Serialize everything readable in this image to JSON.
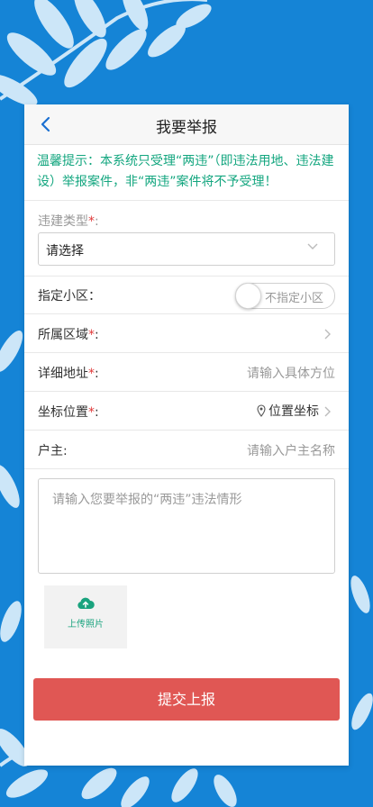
{
  "header": {
    "title": "我要举报"
  },
  "notice": "温馨提示：本系统只受理“两违”（即违法用地、违法建设）举报案件，非“两违”案件将不予受理！",
  "form": {
    "type": {
      "label": "违建类型",
      "req": "*",
      "colon": ":",
      "value": "请选择"
    },
    "community": {
      "label": "指定小区：",
      "toggle_text": "不指定小区"
    },
    "region": {
      "label": "所属区域",
      "req": "*",
      "colon": ":"
    },
    "address": {
      "label": "详细地址",
      "req": "*",
      "colon": ":",
      "placeholder": "请输入具体方位"
    },
    "coords": {
      "label": "坐标位置",
      "req": "*",
      "colon": ":",
      "value": "位置坐标"
    },
    "owner": {
      "label": "户主:",
      "placeholder": "请输入户主名称"
    },
    "description": {
      "placeholder": "请输入您要举报的“两违”违法情形"
    },
    "upload": {
      "label": "上传照片"
    },
    "submit": "提交上报"
  },
  "colors": {
    "background": "#1584d6",
    "notice": "#13a67f",
    "required": "#e03a3a",
    "submit": "#e05754"
  }
}
